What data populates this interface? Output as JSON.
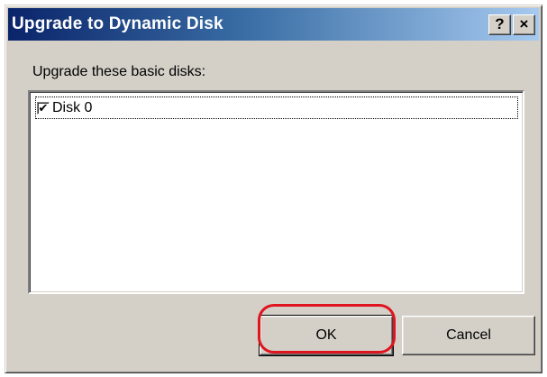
{
  "dialog": {
    "title": "Upgrade to Dynamic Disk",
    "help_button": "?",
    "close_button": "×",
    "instruction": "Upgrade these basic disks:",
    "disks": [
      {
        "label": "Disk 0",
        "checked": true,
        "check_mark": "✔"
      }
    ],
    "ok_label": "OK",
    "cancel_label": "Cancel"
  },
  "annotation": {
    "highlight_color": "#e0141e",
    "highlight_target": "ok-button"
  }
}
